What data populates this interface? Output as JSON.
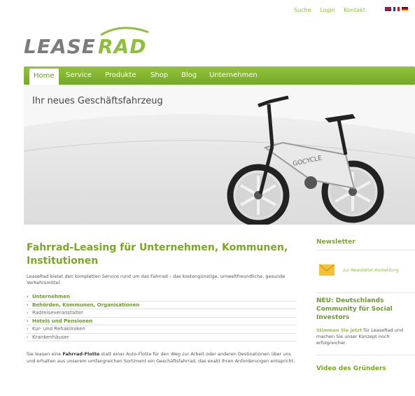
{
  "utility": {
    "search": "Suche",
    "login": "Login",
    "contact": "Kontakt"
  },
  "logo": {
    "text": "LEASERAD"
  },
  "nav": {
    "items": [
      "Home",
      "Service",
      "Produkte",
      "Shop",
      "Blog",
      "Unternehmen"
    ]
  },
  "hero": {
    "title": "Ihr neues Geschäftsfahrzeug",
    "bike_brand": "GOCYCLE"
  },
  "main": {
    "headline_line1": "Fahrrad-Leasing für Unternehmen, Kommunen,",
    "headline_line2": "Institutionen",
    "intro": "LeaseRad bietet den kompletten Service rund um das Fahrrad – das kostengünstige, umweltfreundliche, gesunde Verkehrsmittel.",
    "list": [
      "Unternehmen",
      "Behörden, Kommunen, Organisationen",
      "Radreiseveranstalter",
      "Hotels und Pensionen",
      "Kur- und Rehakliniken",
      "Krankenhäuser"
    ],
    "outro_pre": "Sie leasen eine ",
    "outro_bold": "Fahrrad-Flotte",
    "outro_post": " statt einer Auto-Flotte für den Weg zur Arbeit oder anderen Destinationen über uns und erhalten aus unserem umfangreichen Sortiment ein Geschäftsfahrrad, das exakt Ihren Anforderungen entspricht."
  },
  "sidebar": {
    "newsletter_heading": "Newsletter",
    "newsletter_link": "zur Newsletter-Anmeldung",
    "neu_heading": "NEU: Deutschlands Community für Social Investors",
    "vote_highlight": "Stimmen Sie jetzt",
    "vote_rest": " für LeaseRad und machen Sie unser Konzept noch erfolgreicher.",
    "video_heading": "Video des Gründers"
  },
  "colors": {
    "brand_green": "#7aa825",
    "nav_green": "#85b632"
  }
}
